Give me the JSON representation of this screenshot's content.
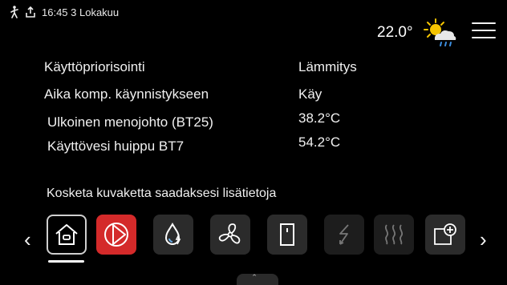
{
  "status_bar": {
    "time_date": "16:45 3 Lokakuu",
    "icons": [
      "person-walking-icon",
      "upload-icon"
    ]
  },
  "weather": {
    "temperature": "22.0°",
    "icon": "sun-cloud-rain-icon"
  },
  "menu": {
    "icon": "hamburger-menu-icon"
  },
  "info_rows": [
    {
      "label": "Käyttöpriorisointi",
      "value": "Lämmitys"
    },
    {
      "label": "Aika komp. käynnistykseen",
      "value": "Käy"
    },
    {
      "label": "Ulkoinen menojohto (BT25)",
      "value": "38.2°C"
    },
    {
      "label": "Käyttövesi huippu BT7",
      "value": "54.2°C"
    }
  ],
  "hint_text": "Kosketa kuvaketta saadaksesi lisätietoja",
  "icon_bar": {
    "left_arrow": "‹",
    "right_arrow": "›",
    "pull_tab_glyph": "ˆ",
    "items": [
      {
        "name": "home-icon",
        "state": "active"
      },
      {
        "name": "compressor-icon",
        "state": "alert",
        "color": "#d42a2a"
      },
      {
        "name": "hot-water-icon",
        "state": "normal"
      },
      {
        "name": "fan-icon",
        "state": "normal"
      },
      {
        "name": "door-icon",
        "state": "normal"
      },
      {
        "name": "electric-heater-icon",
        "state": "disabled"
      },
      {
        "name": "heating-icon",
        "state": "disabled"
      },
      {
        "name": "add-device-icon",
        "state": "normal"
      }
    ]
  },
  "colors": {
    "background": "#000000",
    "alert_red": "#d42a2a",
    "tile_gray": "#2b2b2b",
    "tile_dim": "#1d1d1d"
  }
}
